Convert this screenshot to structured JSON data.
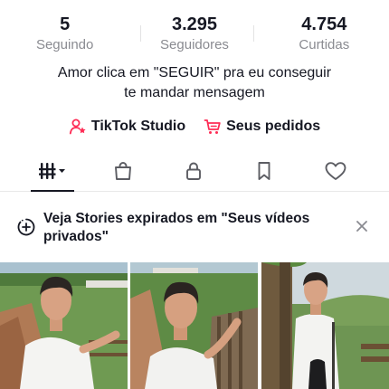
{
  "stats": [
    {
      "value": "5",
      "label": "Seguindo"
    },
    {
      "value": "3.295",
      "label": "Seguidores"
    },
    {
      "value": "4.754",
      "label": "Curtidas"
    }
  ],
  "bio": {
    "line1": "Amor clica em \"SEGUIR\" pra eu conseguir",
    "line2": "te mandar mensagem"
  },
  "links": {
    "studio": {
      "label": "TikTok Studio",
      "icon": "person-star-icon",
      "color": "#fe2c55"
    },
    "orders": {
      "label": "Seus pedidos",
      "icon": "cart-icon",
      "color": "#fe2c55"
    }
  },
  "tabs": [
    {
      "icon": "videos-grid-icon",
      "active": true
    },
    {
      "icon": "shopping-bag-icon",
      "active": false
    },
    {
      "icon": "lock-icon",
      "active": false
    },
    {
      "icon": "bookmark-icon",
      "active": false
    },
    {
      "icon": "heart-icon",
      "active": false
    }
  ],
  "banner": {
    "line1": "Veja Stories expirados em \"Seus vídeos",
    "line2": "privados\"",
    "icon": "add-story-icon"
  },
  "thumbnails": [
    {
      "description": "man-on-farm-path"
    },
    {
      "description": "man-at-wooden-fence"
    },
    {
      "description": "man-by-tree-in-countryside"
    }
  ]
}
